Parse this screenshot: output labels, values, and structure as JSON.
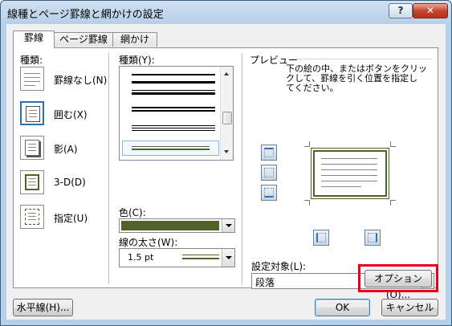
{
  "window": {
    "title": "線種とページ罫線と網かけの設定",
    "help_label": "?",
    "close_label": "✕"
  },
  "tabs": [
    {
      "label": "罫線",
      "active": true
    },
    {
      "label": "ページ罫線",
      "active": false
    },
    {
      "label": "網かけ",
      "active": false
    }
  ],
  "settings": {
    "heading": "種類:",
    "items": [
      {
        "label": "罫線なし(N)",
        "icon": "no-border-icon"
      },
      {
        "label": "囲む(X)",
        "icon": "box-border-icon",
        "selected": true
      },
      {
        "label": "影(A)",
        "icon": "shadow-border-icon"
      },
      {
        "label": "3-D(D)",
        "icon": "3d-border-icon"
      },
      {
        "label": "指定(U)",
        "icon": "custom-border-icon"
      }
    ]
  },
  "style": {
    "heading": "種類(Y):",
    "color_label": "色(C):",
    "color_value": "#4f6228",
    "width_label": "線の太さ(W):",
    "width_value": "1.5 pt"
  },
  "preview": {
    "heading": "プレビュー",
    "instructions": [
      "下の絵の中、またはボタンをクリッ",
      "クして、罫線を引く位置を指定し",
      "てください。"
    ],
    "apply_to_label": "設定対象(L):",
    "apply_to_value": "段落",
    "options_button": "オプション(O)..."
  },
  "footer": {
    "horizontal_line_button": "水平線(H)...",
    "ok_button": "OK",
    "cancel_button": "キャンセル"
  },
  "colors": {
    "accent": "#4f6228",
    "highlight": "#e8001a",
    "selection": "#2b6fb6"
  }
}
